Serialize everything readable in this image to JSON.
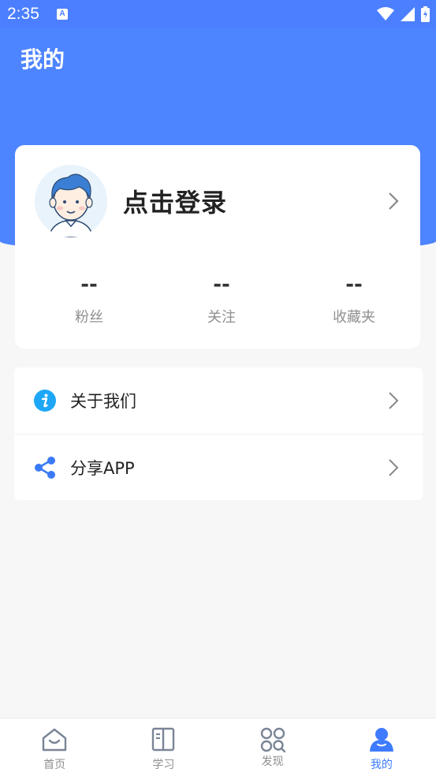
{
  "status_bar": {
    "time": "2:35",
    "app_icon_letter": "A"
  },
  "header": {
    "title": "我的"
  },
  "profile": {
    "login_text": "点击登录",
    "stats": [
      {
        "value": "--",
        "label": "粉丝"
      },
      {
        "value": "--",
        "label": "关注"
      },
      {
        "value": "--",
        "label": "收藏夹"
      }
    ]
  },
  "menu": {
    "items": [
      {
        "label": "关于我们",
        "icon": "info-icon"
      },
      {
        "label": "分享APP",
        "icon": "share-icon"
      }
    ]
  },
  "bottom_nav": {
    "items": [
      {
        "label": "首页",
        "icon": "home-icon",
        "active": false
      },
      {
        "label": "学习",
        "icon": "book-icon",
        "active": false
      },
      {
        "label": "发现",
        "icon": "discover-icon",
        "active": false
      },
      {
        "label": "我的",
        "icon": "profile-icon",
        "active": true
      }
    ]
  },
  "colors": {
    "primary": "#4d84ff",
    "active_nav": "#3e7bff",
    "info_icon": "#1ea7f7",
    "share_icon": "#3a7af5"
  }
}
